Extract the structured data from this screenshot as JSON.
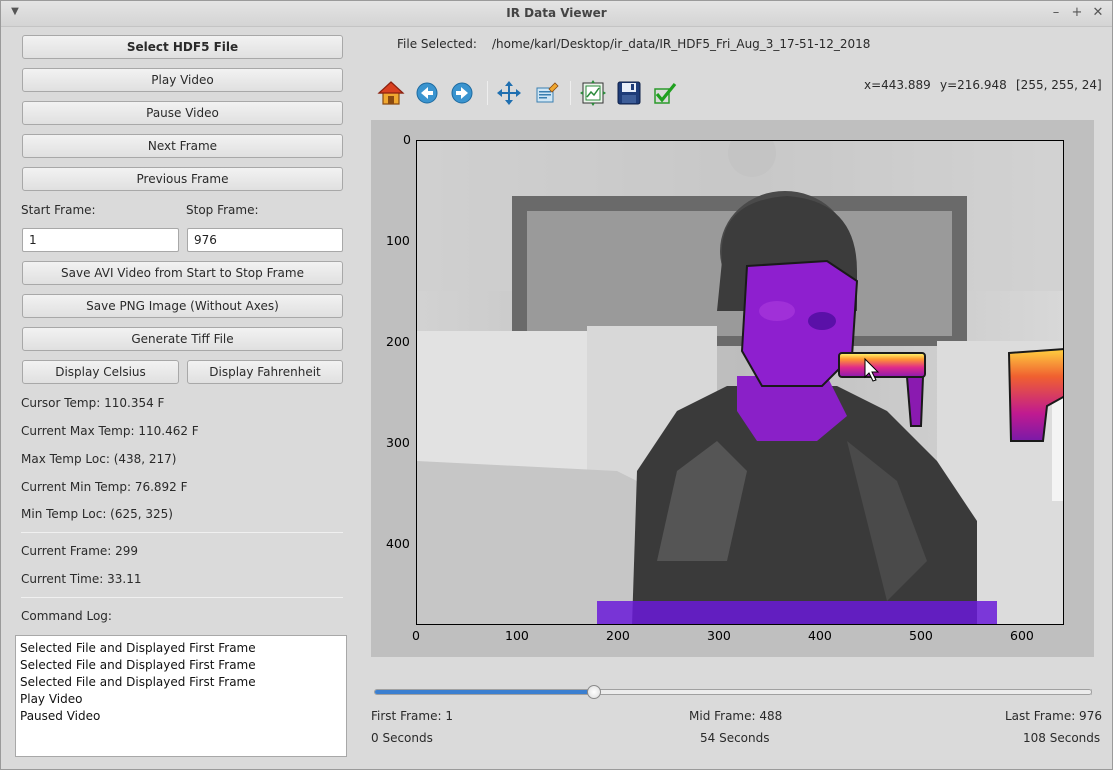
{
  "window": {
    "title": "IR Data Viewer"
  },
  "left_panel": {
    "buttons": {
      "select_file": "Select HDF5 File",
      "play": "Play Video",
      "pause": "Pause Video",
      "next": "Next Frame",
      "previous": "Previous Frame",
      "save_avi": "Save AVI Video from Start to Stop Frame",
      "save_png": "Save PNG Image (Without Axes)",
      "tiff": "Generate Tiff File",
      "celsius": "Display Celsius",
      "fahrenheit": "Display Fahrenheit"
    },
    "start_frame_label": "Start Frame:",
    "stop_frame_label": "Stop Frame:",
    "start_frame_value": "1",
    "stop_frame_value": "976",
    "stats": {
      "cursor_temp": "Cursor Temp: 110.354 F",
      "max_temp": "Current Max Temp: 110.462 F",
      "max_loc": "Max Temp Loc: (438, 217)",
      "min_temp": "Current Min Temp: 76.892 F",
      "min_loc": "Min Temp Loc: (625, 325)",
      "current_frame": "Current Frame: 299",
      "current_time": "Current Time: 33.11"
    },
    "command_log_label": "Command Log:",
    "command_log": [
      "Selected File and Displayed First Frame",
      "Selected File and Displayed First Frame",
      "Selected File and Displayed First Frame",
      "Play Video",
      "Paused Video"
    ]
  },
  "header": {
    "file_selected_label": "File Selected:",
    "file_path": "/home/karl/Desktop/ir_data/IR_HDF5_Fri_Aug_3_17-51-12_2018"
  },
  "toolbar": {
    "icons": [
      "home-icon",
      "back-arrow-icon",
      "forward-arrow-icon",
      "pan-icon",
      "zoom-icon",
      "configure-subplots-icon",
      "save-icon",
      "check-icon"
    ],
    "coord_x": "x=443.889",
    "coord_y": "y=216.948",
    "pixel_value": "[255, 255, 24]"
  },
  "plot": {
    "x_ticks": [
      "0",
      "100",
      "200",
      "300",
      "400",
      "500",
      "600"
    ],
    "y_ticks": [
      "0",
      "100",
      "200",
      "300",
      "400"
    ]
  },
  "slider": {
    "value_fraction": 0.306,
    "first_frame": "First Frame: 1",
    "mid_frame": "Mid Frame: 488",
    "last_frame": "Last Frame: 976",
    "start_seconds": "0 Seconds",
    "mid_seconds": "54 Seconds",
    "end_seconds": "108 Seconds"
  },
  "colors": {
    "accent": "#3b7fd0",
    "hot": "#ffff60",
    "warm_purple": "#9b2bd0"
  }
}
